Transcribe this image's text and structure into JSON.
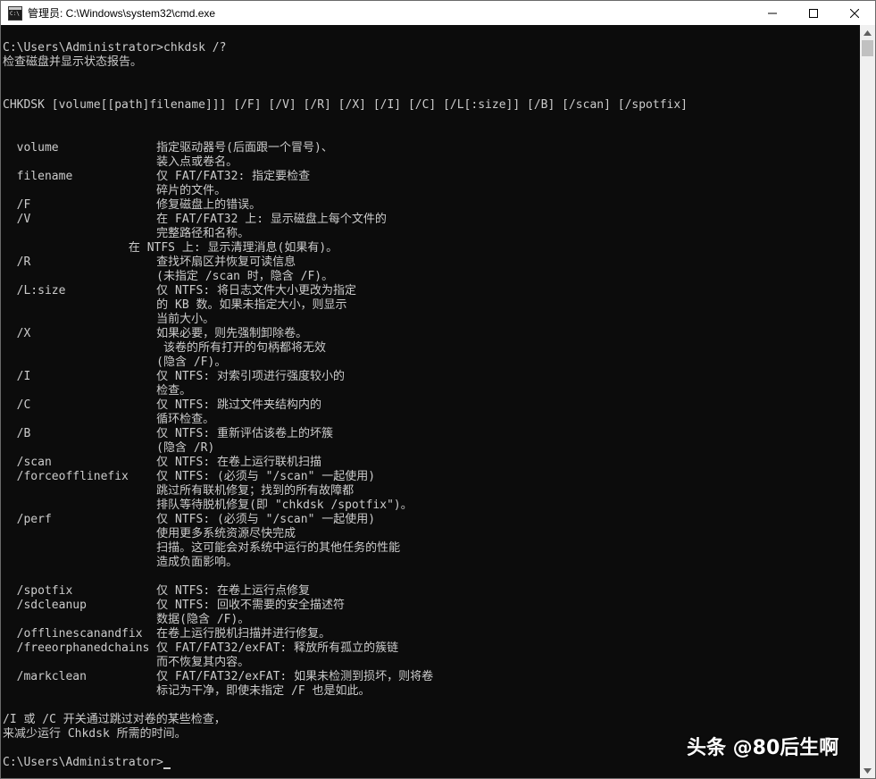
{
  "window": {
    "title": "管理员: C:\\Windows\\system32\\cmd.exe",
    "icon": "console-icon",
    "icon_glyph": "C:\\",
    "buttons": {
      "minimize": "minimize-icon",
      "maximize": "maximize-icon",
      "close": "close-icon"
    }
  },
  "console": {
    "lines": [
      "C:\\Users\\Administrator>chkdsk /?",
      "检查磁盘并显示状态报告。",
      "",
      "",
      "CHKDSK [volume[[path]filename]]] [/F] [/V] [/R] [/X] [/I] [/C] [/L[:size]] [/B] [/scan] [/spotfix]",
      "",
      "",
      "  volume              指定驱动器号(后面跟一个冒号)、",
      "                      装入点或卷名。",
      "  filename            仅 FAT/FAT32: 指定要检查",
      "                      碎片的文件。",
      "  /F                  修复磁盘上的错误。",
      "  /V                  在 FAT/FAT32 上: 显示磁盘上每个文件的",
      "                      完整路径和名称。",
      "                  在 NTFS 上: 显示清理消息(如果有)。",
      "  /R                  查找坏扇区并恢复可读信息",
      "                      (未指定 /scan 时，隐含 /F)。",
      "  /L:size             仅 NTFS: 将日志文件大小更改为指定",
      "                      的 KB 数。如果未指定大小，则显示",
      "                      当前大小。",
      "  /X                  如果必要，则先强制卸除卷。",
      "                       该卷的所有打开的句柄都将无效",
      "                      (隐含 /F)。",
      "  /I                  仅 NTFS: 对索引项进行强度较小的",
      "                      检查。",
      "  /C                  仅 NTFS: 跳过文件夹结构内的",
      "                      循环检查。",
      "  /B                  仅 NTFS: 重新评估该卷上的坏簇",
      "                      (隐含 /R)",
      "  /scan               仅 NTFS: 在卷上运行联机扫描",
      "  /forceofflinefix    仅 NTFS: (必须与 \"/scan\" 一起使用)",
      "                      跳过所有联机修复；找到的所有故障都",
      "                      排队等待脱机修复(即 \"chkdsk /spotfix\")。",
      "  /perf               仅 NTFS: (必须与 \"/scan\" 一起使用)",
      "                      使用更多系统资源尽快完成",
      "                      扫描。这可能会对系统中运行的其他任务的性能",
      "                      造成负面影响。",
      "",
      "  /spotfix            仅 NTFS: 在卷上运行点修复",
      "  /sdcleanup          仅 NTFS: 回收不需要的安全描述符",
      "                      数据(隐含 /F)。",
      "  /offlinescanandfix  在卷上运行脱机扫描并进行修复。",
      "  /freeorphanedchains 仅 FAT/FAT32/exFAT: 释放所有孤立的簇链",
      "                      而不恢复其内容。",
      "  /markclean          仅 FAT/FAT32/exFAT: 如果未检测到损坏，则将卷",
      "                      标记为干净，即使未指定 /F 也是如此。",
      "",
      "/I 或 /C 开关通过跳过对卷的某些检查，",
      "来减少运行 Chkdsk 所需的时间。",
      "",
      "C:\\Users\\Administrator>"
    ]
  },
  "watermark": "头条 @80后生啊"
}
